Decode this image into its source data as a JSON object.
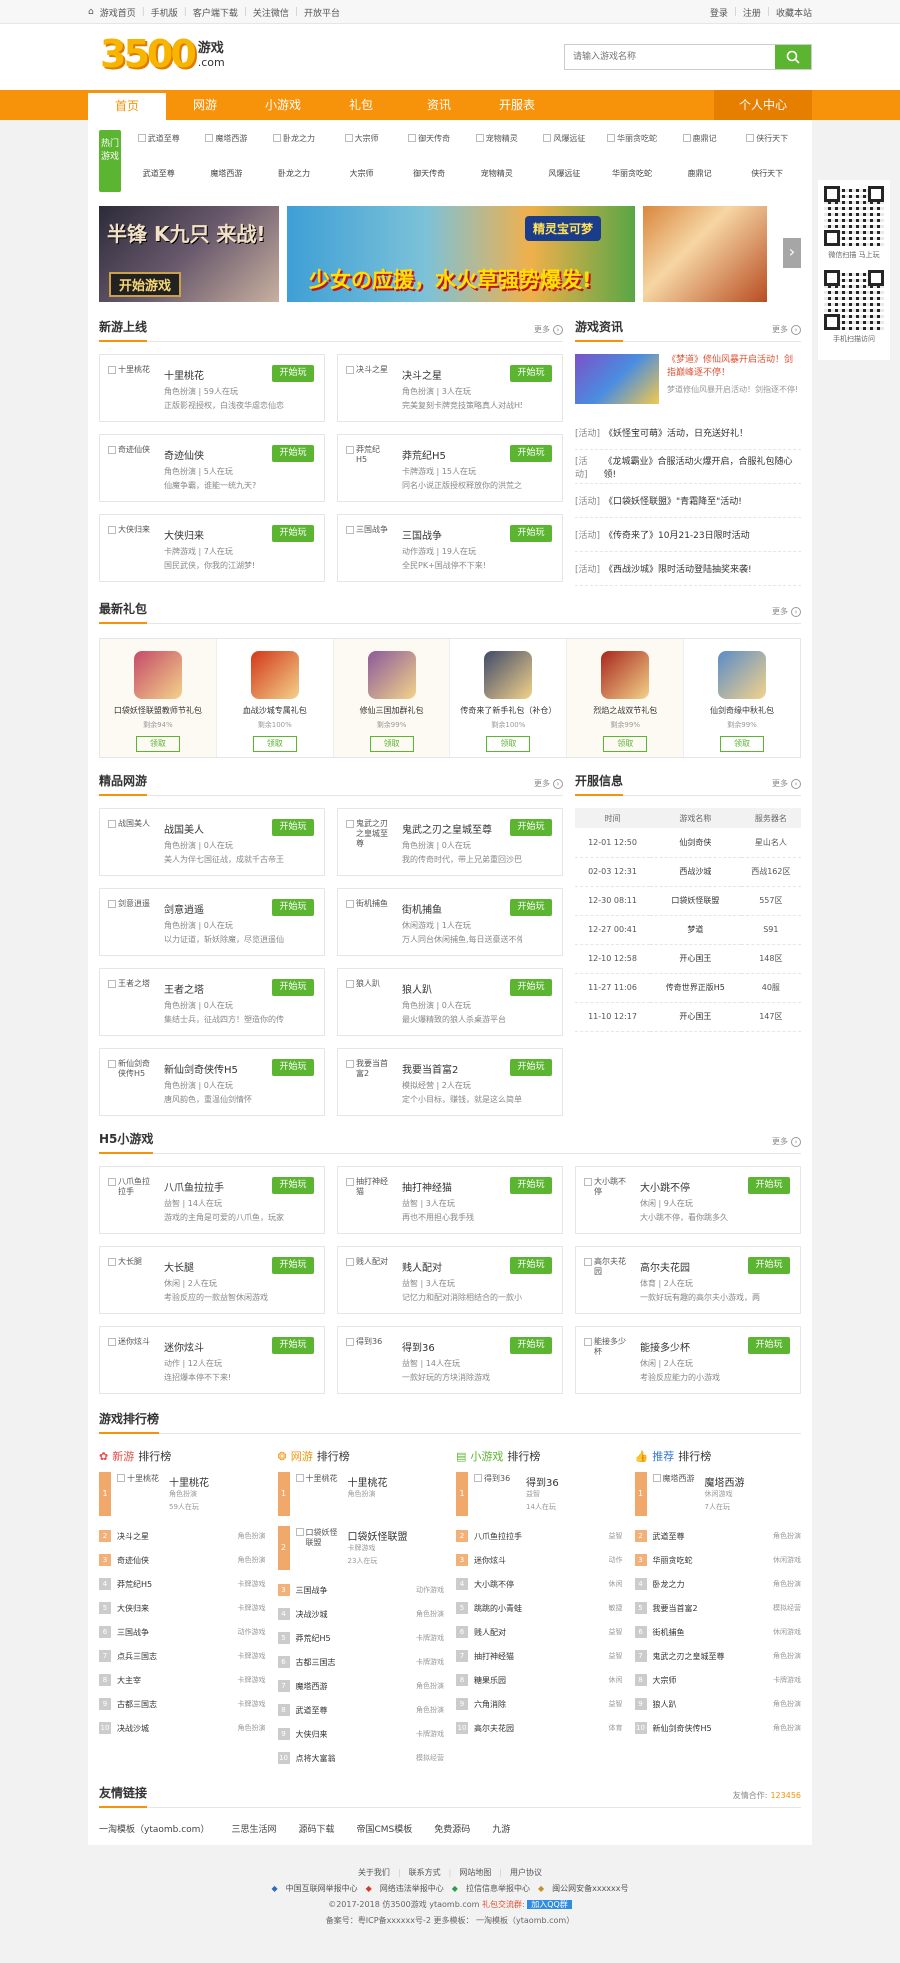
{
  "topbar": {
    "left": [
      "游戏首页",
      "手机版",
      "客户端下载",
      "关注微信",
      "开放平台"
    ],
    "right": [
      "登录",
      "注册",
      "收藏本站"
    ]
  },
  "logo": {
    "num": "3500",
    "text": "游戏",
    "sub": ".com"
  },
  "search": {
    "placeholder": "请输入游戏名称"
  },
  "nav": {
    "items": [
      "首页",
      "网游",
      "小游戏",
      "礼包",
      "资讯",
      "开服表"
    ],
    "ucenter": "个人中心"
  },
  "hot": {
    "tag": "热门游戏",
    "games": [
      "武道至尊",
      "魔塔西游",
      "卧龙之力",
      "大宗师",
      "御天传奇",
      "宠物精灵",
      "风爆远征",
      "华丽贪吃蛇",
      "鹿鼎记",
      "侠行天下"
    ]
  },
  "banners": {
    "b1_t1": "半锋 K九只 来战!",
    "b1_t2": "开始游戏",
    "b2_t": "少女の应援，水火草强势爆发!",
    "b2_logo": "精灵宝可梦"
  },
  "qr": {
    "cap1": "微信扫描 马上玩",
    "cap2": "手机扫描访问"
  },
  "newgames": {
    "title": "新游上线",
    "more": "更多",
    "items": [
      {
        "img": "十里桃花",
        "name": "十里桃花",
        "meta": "角色扮演 | 59人在玩",
        "desc": "正版影视授权，白浅夜华虐恋仙恋之旅"
      },
      {
        "img": "决斗之星",
        "name": "决斗之星",
        "meta": "角色扮演 | 3人在玩",
        "desc": "完美复刻卡牌竞技策略真人对战H5手游"
      },
      {
        "img": "奇迹仙侠",
        "name": "奇迹仙侠",
        "meta": "角色扮演 | 5人在玩",
        "desc": "仙魔争霸，谁能一统九天?"
      },
      {
        "img": "莽荒纪H5",
        "name": "莽荒纪H5",
        "meta": "卡牌游戏 | 15人在玩",
        "desc": "同名小说正版授权释放你的洪荒之力"
      },
      {
        "img": "大侠归来",
        "name": "大侠归来",
        "meta": "卡牌游戏 | 7人在玩",
        "desc": "国民武侠，你我的江湖梦!"
      },
      {
        "img": "三国战争",
        "name": "三国战争",
        "meta": "动作游戏 | 19人在玩",
        "desc": "全民PK+国战停不下来!"
      }
    ]
  },
  "news": {
    "title": "游戏资讯",
    "more": "更多",
    "top": {
      "title": "《梦道》修仙风暴开启活动！剑指巅峰逐不停！",
      "desc": "梦道修仙风暴开启活动！剑指逐不停!"
    },
    "list": [
      {
        "k": "[活动]",
        "t": "《妖怪宝可萌》活动，日充送好礼！"
      },
      {
        "k": "[活动]",
        "t": "《龙城霸业》合服活动火爆开启，合服礼包随心领!"
      },
      {
        "k": "[活动]",
        "t": "《口袋妖怪联盟》\"青霜降至\"活动!"
      },
      {
        "k": "[活动]",
        "t": "《传奇来了》10月21-23日限时活动"
      },
      {
        "k": "[活动]",
        "t": "《西战沙城》限时活动登陆抽奖来袭!"
      }
    ]
  },
  "gifts": {
    "title": "最新礼包",
    "more": "更多",
    "items": [
      {
        "name": "口袋妖怪联盟教师节礼包",
        "left": "剩余94%",
        "btn": "领取",
        "color": "#c64a6a"
      },
      {
        "name": "血战沙城专属礼包",
        "left": "剩余100%",
        "btn": "领取",
        "color": "#d2371a"
      },
      {
        "name": "修仙三国加群礼包",
        "left": "剩余99%",
        "btn": "领取",
        "color": "#8b5a9a"
      },
      {
        "name": "传奇来了新手礼包（补仓）",
        "left": "剩余100%",
        "btn": "领取",
        "color": "#404a6a"
      },
      {
        "name": "烈焰之战双节礼包",
        "left": "剩余99%",
        "btn": "领取",
        "color": "#a8261e"
      },
      {
        "name": "仙剑奇缘中秋礼包",
        "left": "剩余99%",
        "btn": "领取",
        "color": "#5a8cc8"
      }
    ]
  },
  "boutique": {
    "title": "精品网游",
    "more": "更多",
    "items": [
      {
        "img": "战国美人",
        "name": "战国美人",
        "meta": "角色扮演 | 0人在玩",
        "desc": "美人为伴七国征战，成就千古帝王"
      },
      {
        "img": "鬼武之刃之皇城至尊",
        "name": "鬼武之刃之皇城至尊",
        "meta": "角色扮演 | 0人在玩",
        "desc": "我的传奇时代，带上兄弟重回沙巴克!"
      },
      {
        "img": "剑意逍遥",
        "name": "剑意逍遥",
        "meta": "角色扮演 | 0人在玩",
        "desc": "以力证道，斩妖除魔，尽览逍遥仙途"
      },
      {
        "img": "街机捕鱼",
        "name": "街机捕鱼",
        "meta": "休闲游戏 | 1人在玩",
        "desc": "万人同台休闲捕鱼,每日送豪送不停"
      },
      {
        "img": "王者之塔",
        "name": "王者之塔",
        "meta": "角色扮演 | 0人在玩",
        "desc": "集结士兵，征战四方！塑造你的传奇！"
      },
      {
        "img": "狼人趴",
        "name": "狼人趴",
        "meta": "角色扮演 | 0人在玩",
        "desc": "最火爆精致的狼人杀桌游平台"
      },
      {
        "img": "新仙剑奇侠传H5",
        "name": "新仙剑奇侠传H5",
        "meta": "角色扮演 | 0人在玩",
        "desc": "唐风韵色，重温仙剑情怀"
      },
      {
        "img": "我要当首富2",
        "name": "我要当首富2",
        "meta": "模拟经营 | 2人在玩",
        "desc": "定个小目标，赚钱，就是这么简单!"
      }
    ]
  },
  "kaifu": {
    "title": "开服信息",
    "more": "更多",
    "head": [
      "时间",
      "游戏名称",
      "服务器名"
    ],
    "rows": [
      [
        "12-01 12:50",
        "仙剑奇侠",
        "星山名人"
      ],
      [
        "02-03 12:31",
        "西战沙城",
        "西战162区"
      ],
      [
        "12-30 08:11",
        "口袋妖怪联盟",
        "557区"
      ],
      [
        "12-27 00:41",
        "梦道",
        "S91"
      ],
      [
        "12-10 12:58",
        "开心国王",
        "148区"
      ],
      [
        "11-27 11:06",
        "传奇世界正版H5",
        "40服"
      ],
      [
        "11-10 12:17",
        "开心国王",
        "147区"
      ]
    ]
  },
  "h5": {
    "title": "H5小游戏",
    "more": "更多",
    "items": [
      {
        "img": "八爪鱼拉拉手",
        "name": "八爪鱼拉拉手",
        "meta": "益智 | 14人在玩",
        "desc": "游戏的主角是可爱的八爪鱼，玩家要合理的控..."
      },
      {
        "img": "抽打神经猫",
        "name": "抽打神经猫",
        "meta": "益智 | 3人在玩",
        "desc": "再也不用担心我手残"
      },
      {
        "img": "大小跳不停",
        "name": "大小跳不停",
        "meta": "休闲 | 9人在玩",
        "desc": "大小跳不停，看你跳多久"
      },
      {
        "img": "大长腿",
        "name": "大长腿",
        "meta": "休闲 | 2人在玩",
        "desc": "考验反应的一款益智休闲游戏"
      },
      {
        "img": "贱人配对",
        "name": "贱人配对",
        "meta": "益智 | 3人在玩",
        "desc": "记忆力和配对消除相结合的一款小游戏"
      },
      {
        "img": "高尔夫花园",
        "name": "高尔夫花园",
        "meta": "体育 | 2人在玩",
        "desc": "一款好玩有趣的高尔夫小游戏，两种模式让..."
      },
      {
        "img": "迷你炫斗",
        "name": "迷你炫斗",
        "meta": "动作 | 12人在玩",
        "desc": "连招爆本停不下来!"
      },
      {
        "img": "得到36",
        "name": "得到36",
        "meta": "益智 | 14人在玩",
        "desc": "一款好玩的方块消除游戏"
      },
      {
        "img": "能接多少杯",
        "name": "能接多少杯",
        "meta": "休闲 | 2人在玩",
        "desc": "考验反应能力的小游戏"
      }
    ]
  },
  "rank": {
    "title": "游戏排行榜",
    "lists": [
      {
        "title_a": "新游",
        "title_b": "排行榜",
        "icon": "✿",
        "color": "#e84a4a",
        "first": {
          "img": "十里桃花",
          "name": "十里桃花",
          "t": "角色扮演",
          "p": "59人在玩"
        },
        "items": [
          [
            "决斗之星",
            "角色扮演"
          ],
          [
            "奇迹仙侠",
            "角色扮演"
          ],
          [
            "莽荒纪H5",
            "卡牌游戏"
          ],
          [
            "大侠归来",
            "卡牌游戏"
          ],
          [
            "三国战争",
            "动作游戏"
          ],
          [
            "点兵三国志",
            "卡牌游戏"
          ],
          [
            "大主宰",
            "卡牌游戏"
          ],
          [
            "古都三国志",
            "卡牌游戏"
          ],
          [
            "决战沙城",
            "角色扮演"
          ]
        ]
      },
      {
        "title_a": "网游",
        "title_b": "排行榜",
        "icon": "❂",
        "color": "#f7930a",
        "first": {
          "img": "十里桃花",
          "name": "十里桃花",
          "t": "角色扮演",
          "p": ""
        },
        "second": {
          "img": "口袋妖怪联盟",
          "name": "口袋妖怪联盟",
          "t": "卡牌游戏",
          "p": "23人在玩"
        },
        "items": [
          [
            "三国战争",
            "动作游戏"
          ],
          [
            "决战沙城",
            "角色扮演"
          ],
          [
            "莽荒纪H5",
            "卡牌游戏"
          ],
          [
            "古都三国志",
            "卡牌游戏"
          ],
          [
            "魔塔西游",
            "角色扮演"
          ],
          [
            "武道至尊",
            "角色扮演"
          ],
          [
            "大侠归来",
            "卡牌游戏"
          ],
          [
            "点将大富翁",
            "模拟经营"
          ]
        ]
      },
      {
        "title_a": "小游戏",
        "title_b": "排行榜",
        "icon": "▤",
        "color": "#5cb531",
        "first": {
          "img": "得到36",
          "name": "得到36",
          "t": "益智",
          "p": "14人在玩"
        },
        "items": [
          [
            "八爪鱼拉拉手",
            "益智"
          ],
          [
            "迷你炫斗",
            "动作"
          ],
          [
            "大小跳不停",
            "休闲"
          ],
          [
            "跳跳的小青蛙",
            "敏捷"
          ],
          [
            "贱人配对",
            "益智"
          ],
          [
            "抽打神经猫",
            "益智"
          ],
          [
            "糖果乐园",
            "休闲"
          ],
          [
            "六角消除",
            "益智"
          ],
          [
            "高尔夫花园",
            "体育"
          ]
        ]
      },
      {
        "title_a": "推荐",
        "title_b": "排行榜",
        "icon": "👍",
        "color": "#3a7bd5",
        "first": {
          "img": "魔塔西游",
          "name": "魔塔西游",
          "t": "休闲游戏",
          "p": "7人在玩"
        },
        "items": [
          [
            "武道至尊",
            "角色扮演"
          ],
          [
            "华丽贪吃蛇",
            "休闲游戏"
          ],
          [
            "卧龙之力",
            "角色扮演"
          ],
          [
            "我要当首富2",
            "模拟经营"
          ],
          [
            "街机捕鱼",
            "休闲游戏"
          ],
          [
            "鬼武之刃之皇城至尊",
            "角色扮演"
          ],
          [
            "大宗师",
            "卡牌游戏"
          ],
          [
            "狼人趴",
            "角色扮演"
          ],
          [
            "新仙剑奇侠传H5",
            "角色扮演"
          ]
        ]
      }
    ]
  },
  "friends": {
    "title": "友情链接",
    "coop": "友情合作:",
    "qq": "123456",
    "items": [
      "一淘模板（ytaomb.com）",
      "三思生活网",
      "源码下载",
      "帝国CMS模板",
      "免费源码",
      "九游"
    ]
  },
  "footer": {
    "links": [
      "关于我们",
      "联系方式",
      "网站地图",
      "用户协议"
    ],
    "badges": [
      "中国互联网举报中心",
      "网络违法举报中心",
      "拉信信息举报中心",
      "闽公网安备xxxxxx号"
    ],
    "copy": "©2017-2018  仿3500游戏  ytaomb.com",
    "qqgroup": "礼包交流群:",
    "joinqq": "加入QQ群",
    "icp": "备案号：粤ICP备xxxxxx号-2   更多模板： 一淘模板（ytaomb.com）"
  }
}
